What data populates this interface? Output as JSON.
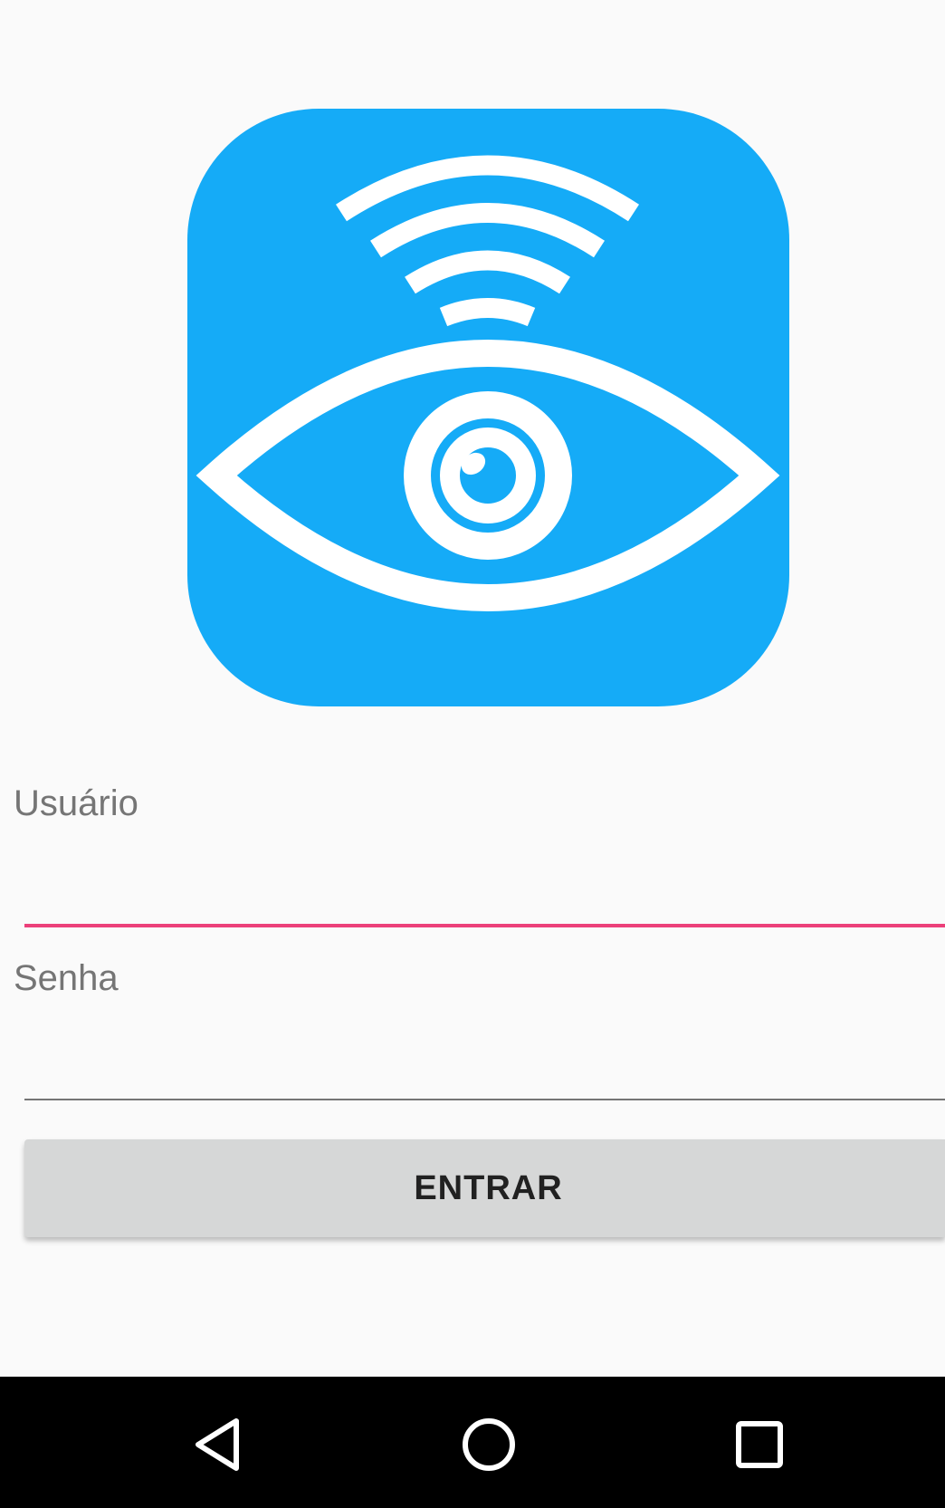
{
  "app": {
    "brand_color": "#15abf7",
    "accent_color": "#ec407a",
    "logo_icon": "wifi-eye-icon"
  },
  "form": {
    "username": {
      "label": "Usuário",
      "value": "",
      "underline_color": "#ec407a",
      "focused": true
    },
    "password": {
      "label": "Senha",
      "value": "",
      "underline_color": "#757575",
      "focused": false
    },
    "submit_label": "ENTRAR"
  },
  "navigation_bar": {
    "buttons": [
      "back-icon",
      "home-icon",
      "recents-icon"
    ]
  }
}
